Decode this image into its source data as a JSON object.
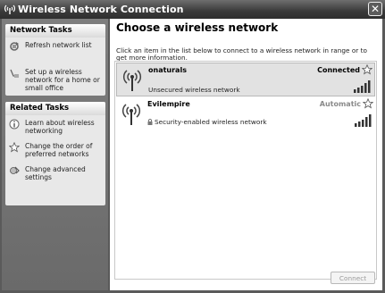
{
  "window": {
    "title": "Wireless Network Connection"
  },
  "sidebar": {
    "network_tasks": {
      "title": "Network Tasks",
      "items": [
        {
          "label": "Refresh network list",
          "icon": "refresh-icon"
        },
        {
          "label": "Set up a wireless network for a home or small office",
          "icon": "setup-wizard-icon"
        }
      ]
    },
    "related_tasks": {
      "title": "Related Tasks",
      "items": [
        {
          "label": "Learn about wireless networking",
          "icon": "info-icon"
        },
        {
          "label": "Change the order of preferred networks",
          "icon": "star-icon"
        },
        {
          "label": "Change advanced settings",
          "icon": "settings-icon"
        }
      ]
    }
  },
  "main": {
    "heading": "Choose a wireless network",
    "instruction": "Click an item in the list below to connect to a wireless network in range or to get more information.",
    "networks": [
      {
        "name": "onaturals",
        "description": "Unsecured wireless network",
        "status": "Connected",
        "secured": false,
        "signal_bars": 5,
        "selected": true
      },
      {
        "name": "Evilempire",
        "description": "Security-enabled wireless network",
        "status": "Automatic",
        "secured": true,
        "signal_bars": 5,
        "selected": false
      }
    ],
    "connect_label": "Connect"
  }
}
